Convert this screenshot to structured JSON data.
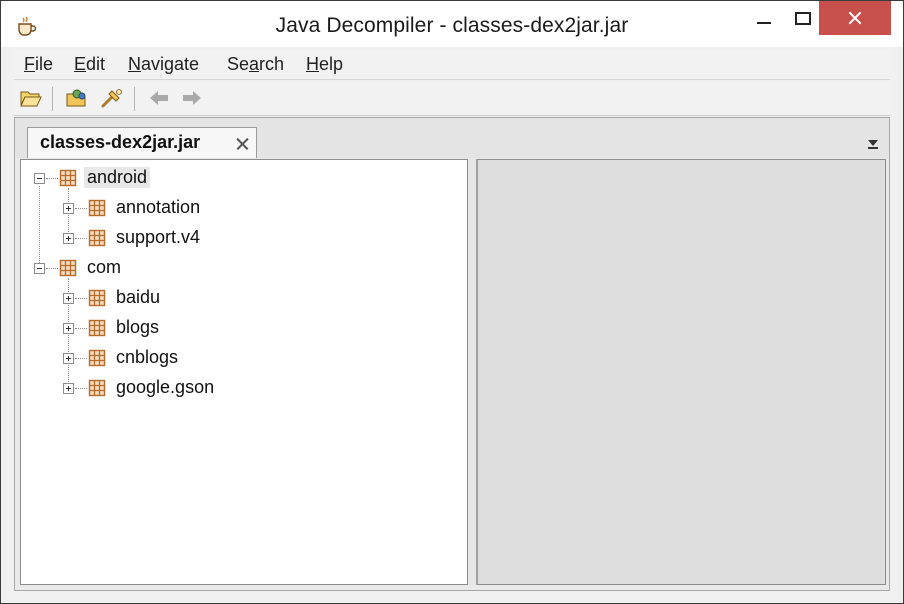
{
  "window": {
    "title": "Java Decompiler - classes-dex2jar.jar"
  },
  "menu": [
    {
      "label": "File",
      "mnemonic": "F",
      "rest": "ile"
    },
    {
      "label": "Edit",
      "mnemonic": "E",
      "rest": "dit"
    },
    {
      "label": "Navigate",
      "mnemonic": "N",
      "rest": "avigate"
    },
    {
      "label": "Search",
      "pre": "Se",
      "mnemonic": "a",
      "rest": "rch"
    },
    {
      "label": "Help",
      "mnemonic": "H",
      "rest": "elp"
    }
  ],
  "toolbar": {
    "buttons": [
      "open-folder-icon",
      "open-type-icon",
      "open-search-icon",
      "back-arrow-icon",
      "forward-arrow-icon"
    ]
  },
  "tab": {
    "label": "classes-dex2jar.jar"
  },
  "tree": {
    "nodes": [
      {
        "label": "android",
        "level": 0,
        "expanded": true,
        "selected": true
      },
      {
        "label": "annotation",
        "level": 1,
        "expanded": false
      },
      {
        "label": "support.v4",
        "level": 1,
        "expanded": false
      },
      {
        "label": "com",
        "level": 0,
        "expanded": true
      },
      {
        "label": "baidu",
        "level": 1,
        "expanded": false
      },
      {
        "label": "blogs",
        "level": 1,
        "expanded": false
      },
      {
        "label": "cnblogs",
        "level": 1,
        "expanded": false
      },
      {
        "label": "google.gson",
        "level": 1,
        "expanded": false
      }
    ]
  },
  "colors": {
    "close_button": "#c7504c",
    "package_icon": "#c57a34",
    "content_pane": "#dedede"
  }
}
